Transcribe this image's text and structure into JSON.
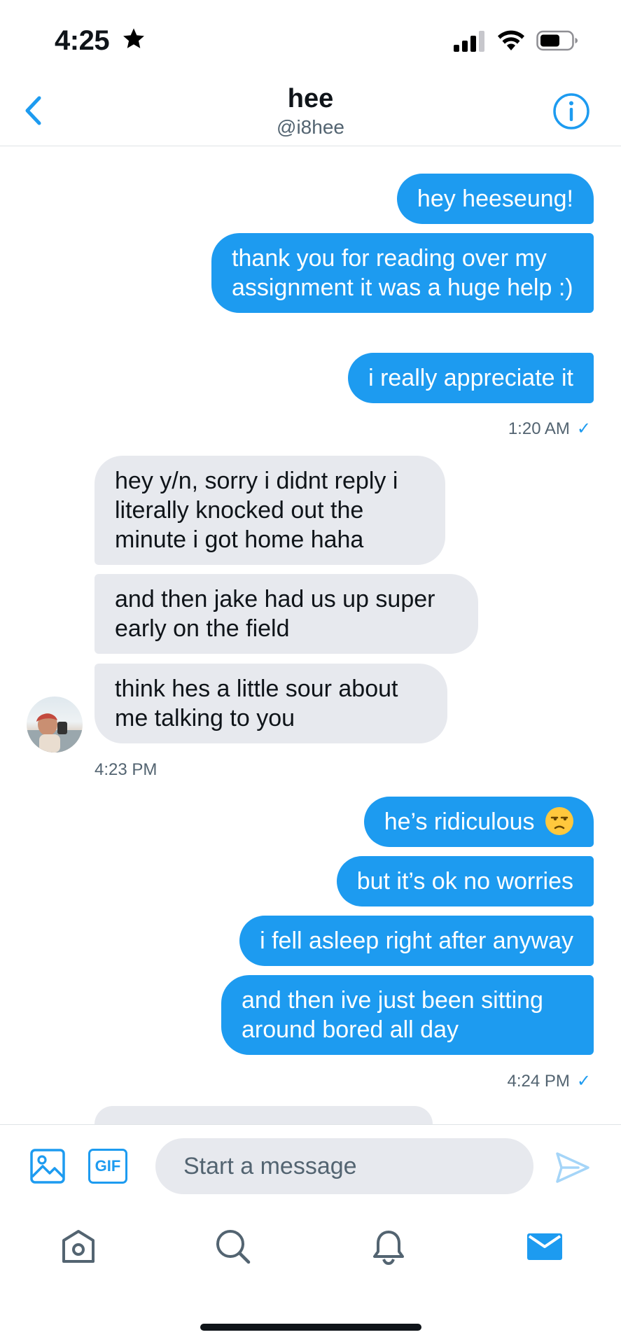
{
  "status_bar": {
    "time": "4:25"
  },
  "header": {
    "name": "hee",
    "handle": "@i8hee"
  },
  "messages": {
    "m1": "hey heeseung!",
    "m2": "thank you for reading over my assignment it was a huge help :)",
    "m3": "i really appreciate it",
    "t1": "1:20 AM",
    "m4": "hey y/n, sorry i didnt reply i literally knocked out the minute i got home haha",
    "m5": "and then jake had us up super early on the field",
    "m6": "think hes a little sour about me talking to you",
    "t2": "4:23 PM",
    "m7": "he’s ridiculous",
    "m8": "but it’s ok no worries",
    "m9": "i fell asleep right after anyway",
    "m10": "and then ive just been sitting around bored all day",
    "t3": "4:24 PM"
  },
  "composer": {
    "gif_label": "GIF",
    "placeholder": "Start a message"
  },
  "colors": {
    "accent": "#1d9bf0",
    "incoming_bubble": "#e7e9ee",
    "secondary_text": "#536471"
  },
  "icons": [
    "star-icon",
    "signal-icon",
    "wifi-icon",
    "battery-icon",
    "back-chevron-icon",
    "info-icon",
    "unamused-emoji-icon",
    "image-icon",
    "send-icon",
    "home-icon",
    "search-icon",
    "bell-icon",
    "mail-icon"
  ]
}
